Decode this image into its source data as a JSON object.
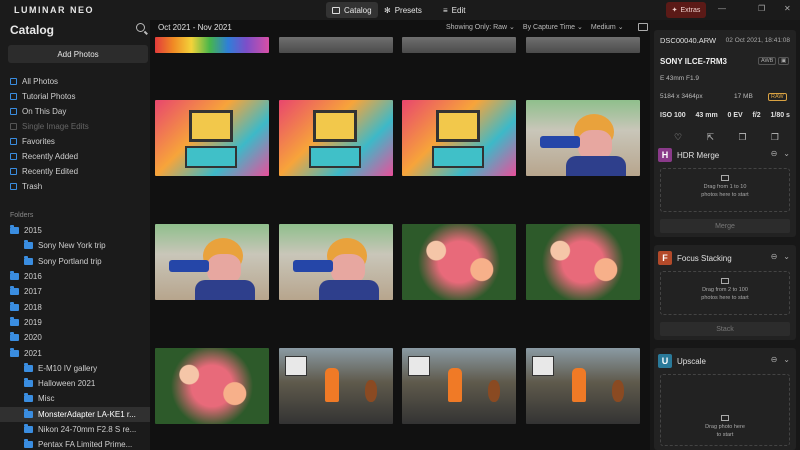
{
  "app": {
    "brand": "LUMINAR NEO"
  },
  "nav": {
    "catalog": "Catalog",
    "presets": "Presets",
    "edit": "Edit",
    "extras": "Extras"
  },
  "window": {
    "minimize": "—",
    "restore": "❐",
    "close": "✕"
  },
  "sidebar": {
    "title": "Catalog",
    "add_photos": "Add Photos",
    "items": [
      {
        "label": "All Photos",
        "enabled": true
      },
      {
        "label": "Tutorial Photos",
        "enabled": true
      },
      {
        "label": "On This Day",
        "enabled": true
      },
      {
        "label": "Single Image Edits",
        "enabled": false
      },
      {
        "label": "Favorites",
        "enabled": true
      },
      {
        "label": "Recently Added",
        "enabled": true
      },
      {
        "label": "Recently Edited",
        "enabled": true
      },
      {
        "label": "Trash",
        "enabled": true
      }
    ],
    "folders_label": "Folders",
    "folders": [
      {
        "label": "2015",
        "sub": false
      },
      {
        "label": "Sony New York trip",
        "sub": true
      },
      {
        "label": "Sony Portland trip",
        "sub": true
      },
      {
        "label": "2016",
        "sub": false
      },
      {
        "label": "2017",
        "sub": false
      },
      {
        "label": "2018",
        "sub": false
      },
      {
        "label": "2019",
        "sub": false
      },
      {
        "label": "2020",
        "sub": false
      },
      {
        "label": "2021",
        "sub": false
      },
      {
        "label": "E-M10 IV gallery",
        "sub": true
      },
      {
        "label": "Halloween 2021",
        "sub": true
      },
      {
        "label": "Misc",
        "sub": true
      },
      {
        "label": "MonsterAdapter LA-KE1 r...",
        "sub": true,
        "selected": true
      },
      {
        "label": "Nikon 24-70mm F2.8 S re...",
        "sub": true
      },
      {
        "label": "Pentax FA Limited Prime...",
        "sub": true
      }
    ]
  },
  "main": {
    "date_range": "Oct 2021 - Nov 2021",
    "filter_show": "Showing Only: Raw ⌄",
    "filter_sort": "By Capture Time ⌄",
    "filter_size": "Medium ⌄"
  },
  "info": {
    "filename": "DSC00040.ARW",
    "date": "02 Oct 2021, 18:41:08",
    "camera": "SONY ILCE-7RM3",
    "lens": "E 43mm F1.9",
    "awb": "AWB",
    "resolution": "5184 x 3464px",
    "filesize": "17 MB",
    "raw_badge": "RAW",
    "iso": "ISO 100",
    "focal": "43 mm",
    "ev": "0 EV",
    "aperture": "f/2",
    "shutter": "1/80 s"
  },
  "tools": [
    {
      "letter": "H",
      "title": "HDR Merge",
      "color": "#8a3a8a",
      "drop_line1": "Drag from 1 to 10",
      "drop_line2": "photos here to start",
      "button": "Merge"
    },
    {
      "letter": "F",
      "title": "Focus Stacking",
      "color": "#b34a2a",
      "drop_line1": "Drag from 2 to 100",
      "drop_line2": "photos here to start",
      "button": "Stack"
    },
    {
      "letter": "U",
      "title": "Upscale",
      "color": "#2a7a9a",
      "drop_line1": "Drag photo here",
      "drop_line2": "to start",
      "button": ""
    }
  ]
}
